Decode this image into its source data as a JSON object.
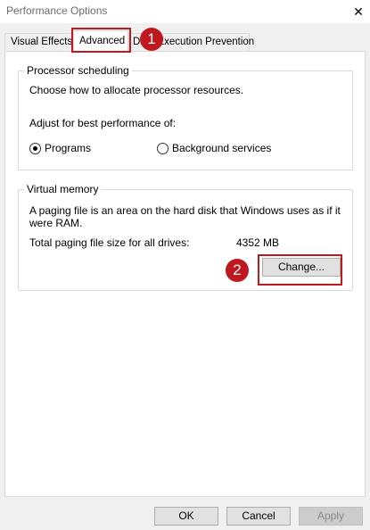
{
  "window": {
    "title": "Performance Options",
    "close_glyph": "✕"
  },
  "tabs": [
    {
      "label": "Visual Effects"
    },
    {
      "label": "Advanced"
    },
    {
      "label": "Data Execution Prevention"
    }
  ],
  "processor": {
    "legend": "Processor scheduling",
    "description": "Choose how to allocate processor resources.",
    "adjust_label": "Adjust for best performance of:",
    "options": [
      {
        "label": "Programs",
        "checked": true
      },
      {
        "label": "Background services",
        "checked": false
      }
    ]
  },
  "virtual_memory": {
    "legend": "Virtual memory",
    "description_line1": "A paging file is an area on the hard disk that Windows uses as if it",
    "description_line2": "were RAM.",
    "total_label": "Total paging file size for all drives:",
    "total_value": "4352 MB",
    "change_button": "Change..."
  },
  "footer": {
    "ok": "OK",
    "cancel": "Cancel",
    "apply": "Apply"
  },
  "annotations": {
    "badge1": "1",
    "badge2": "2",
    "highlight_color": "#c0181f"
  }
}
